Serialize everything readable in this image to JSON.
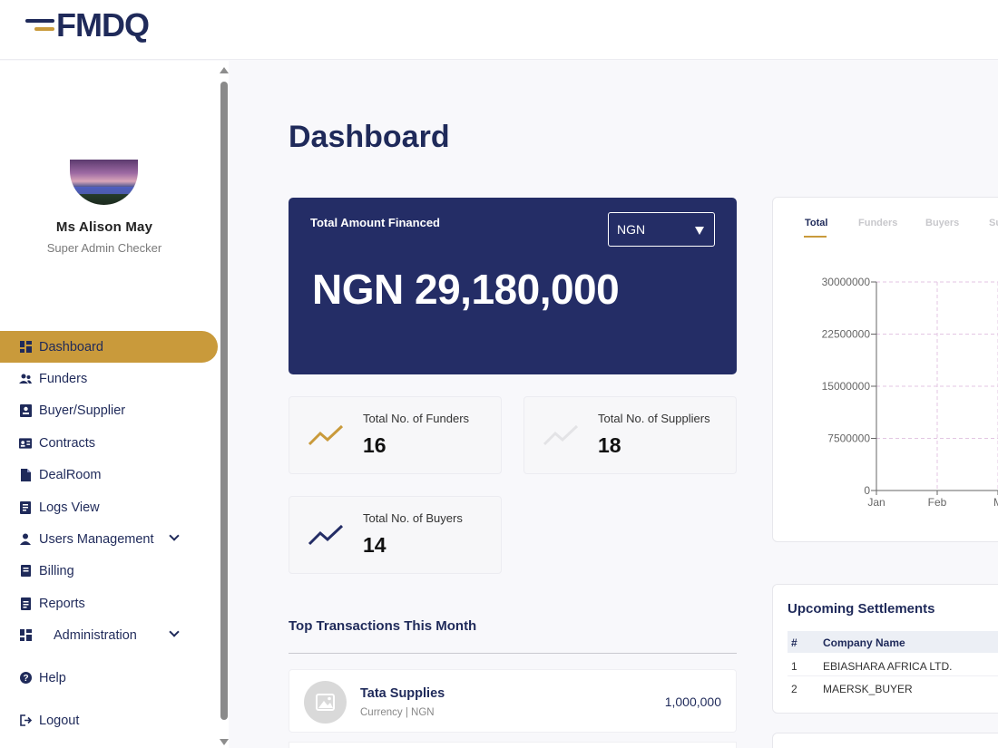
{
  "brand": {
    "logo_text": "FMDQ"
  },
  "user": {
    "name": "Ms Alison May",
    "role": "Super Admin Checker"
  },
  "sidebar": {
    "items": [
      {
        "label": "Dashboard",
        "icon": "grid-icon",
        "active": true
      },
      {
        "label": "Funders",
        "icon": "users-icon"
      },
      {
        "label": "Buyer/Supplier",
        "icon": "id-card-icon"
      },
      {
        "label": "Contracts",
        "icon": "contract-icon"
      },
      {
        "label": "DealRoom",
        "icon": "document-icon"
      },
      {
        "label": "Logs View",
        "icon": "log-book-icon"
      },
      {
        "label": "Users Management",
        "icon": "user-icon",
        "expandable": true
      },
      {
        "label": "Billing",
        "icon": "billing-icon"
      },
      {
        "label": "Reports",
        "icon": "report-icon"
      },
      {
        "label": "Administration",
        "icon": "admin-grid-icon",
        "expandable": true
      },
      {
        "label": "Help",
        "icon": "help-icon"
      },
      {
        "label": "Logout",
        "icon": "logout-icon"
      }
    ]
  },
  "page": {
    "title": "Dashboard"
  },
  "hero": {
    "label": "Total Amount Financed",
    "currency_selected": "NGN",
    "amount": "NGN 29,180,000"
  },
  "stats": {
    "funders": {
      "label": "Total No. of Funders",
      "value": "16"
    },
    "suppliers": {
      "label": "Total No. of Suppliers",
      "value": "18"
    },
    "buyers": {
      "label": "Total No. of Buyers",
      "value": "14"
    }
  },
  "transactions": {
    "title": "Top Transactions This Month",
    "items": [
      {
        "name": "Tata Supplies",
        "sub": "Currency | NGN",
        "amount": "1,000,000"
      }
    ]
  },
  "chart": {
    "tabs": [
      "Total",
      "Funders",
      "Buyers",
      "Su"
    ],
    "active_tab": "Total"
  },
  "chart_data": {
    "type": "line",
    "categories": [
      "Jan",
      "Feb",
      "M"
    ],
    "yticks": [
      "30000000",
      "22500000",
      "15000000",
      "7500000",
      "0"
    ],
    "ylim": [
      0,
      30000000
    ],
    "grid": true,
    "series": []
  },
  "settlements": {
    "title": "Upcoming Settlements",
    "columns": [
      "#",
      "Company Name"
    ],
    "rows": [
      {
        "num": "1",
        "company": "EBIASHARA AFRICA LTD."
      },
      {
        "num": "2",
        "company": "MAERSK_BUYER"
      }
    ]
  },
  "colors": {
    "navy": "#242d66",
    "gold": "#c99a3b"
  }
}
